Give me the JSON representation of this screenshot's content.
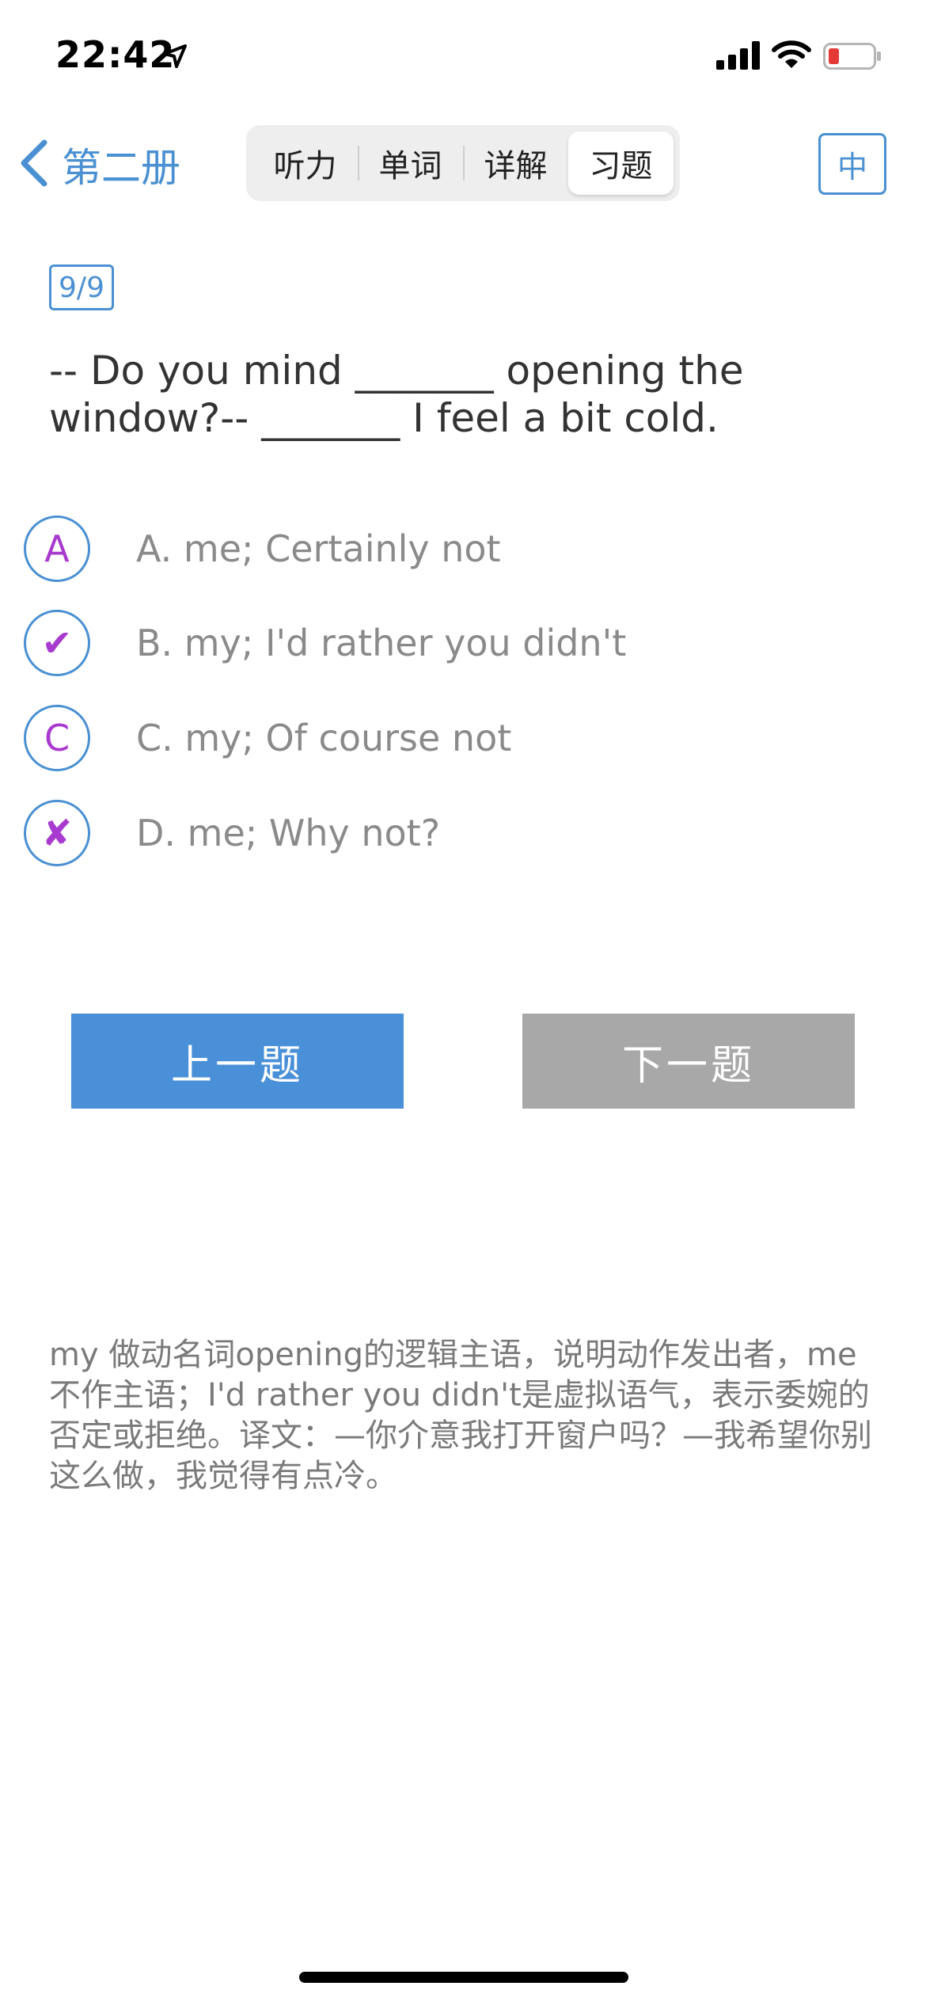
{
  "status_bar": {
    "time": "22:42"
  },
  "nav": {
    "back_label": "第二册",
    "tabs": [
      {
        "label": "听力"
      },
      {
        "label": "单词"
      },
      {
        "label": "详解"
      },
      {
        "label": "习题"
      }
    ],
    "active_tab": "习题",
    "lang_button": "中"
  },
  "question": {
    "counter": "9/9",
    "text": "-- Do you mind _______ opening the window?-- _______ I feel a bit cold.",
    "options": [
      {
        "marker": "A",
        "marker_type": "letter",
        "text": "A. me; Certainly not"
      },
      {
        "marker": "✔",
        "marker_type": "correct",
        "text": "B. my; I'd rather you didn't"
      },
      {
        "marker": "C",
        "marker_type": "letter",
        "text": "C. my; Of course not"
      },
      {
        "marker": "✘",
        "marker_type": "wrong",
        "text": "D. me; Why not?"
      }
    ]
  },
  "buttons": {
    "prev": "上一题",
    "next": "下一题"
  },
  "explanation": "my 做动名词opening的逻辑主语，说明动作发出者，me不作主语；I'd rather you didn't是虚拟语气，表示委婉的否定或拒绝。译文：—你介意我打开窗户吗？—我希望你别这么做，我觉得有点冷。",
  "colors": {
    "accent": "#4a90d2",
    "marker": "#a83ad0",
    "prev_button": "#4a90d8",
    "next_button": "#a8a8a8"
  }
}
